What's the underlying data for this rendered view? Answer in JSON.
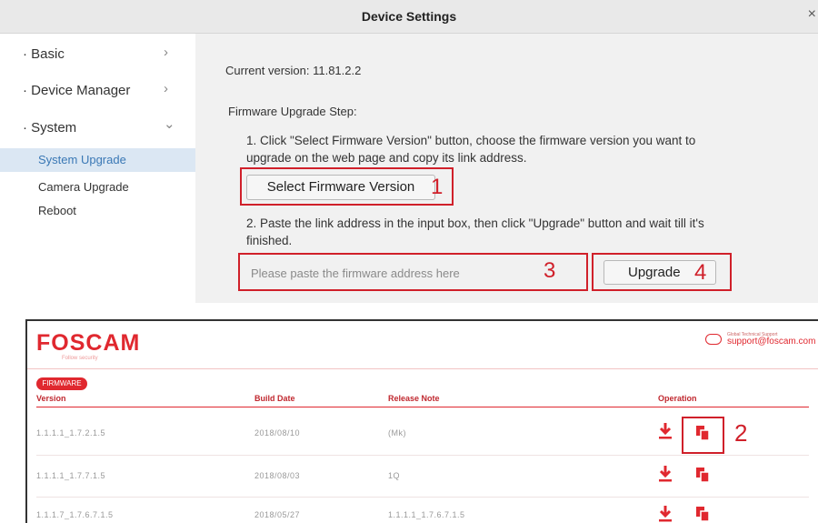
{
  "dialog": {
    "title": "Device Settings",
    "close_glyph": "×"
  },
  "sidebar": {
    "items": [
      {
        "label": "· Basic",
        "chevron": "›",
        "icon": "chevron-right-icon"
      },
      {
        "label": "· Device Manager",
        "chevron": "›",
        "icon": "chevron-right-icon"
      },
      {
        "label": "· System",
        "chevron": "⌄",
        "icon": "chevron-down-icon"
      }
    ],
    "subitems": [
      {
        "label": "System Upgrade",
        "active": true
      },
      {
        "label": "Camera Upgrade",
        "active": false
      },
      {
        "label": "Reboot",
        "active": false
      }
    ]
  },
  "content": {
    "current_version": "Current version: 11.81.2.2",
    "steps_title": "Firmware Upgrade Step:",
    "step1_line1": "1. Click \"Select Firmware Version\" button, choose the firmware version you want to",
    "step1_line2": "upgrade on the web page and copy its link address.",
    "select_button": "Select Firmware Version",
    "step2_line1": "2. Paste the link address in the input box, then click \"Upgrade\" button and wait till it's",
    "step2_line2": "finished.",
    "input_placeholder": "Please paste the firmware address here",
    "upgrade_button": "Upgrade",
    "callouts": {
      "one": "1",
      "three": "3",
      "four": "4"
    }
  },
  "foscam": {
    "logo": "FOSCAM",
    "tagline": "Follow security",
    "support_small": "Global Technical Support",
    "support_email": "support@foscam.com",
    "badge": "FIRMWARE",
    "columns": {
      "version": "Version",
      "build_date": "Build Date",
      "release_note": "Release Note",
      "operation": "Operation"
    },
    "rows": [
      {
        "version": "1.1.1.1_1.7.2.1.5",
        "build_date": "2018/08/10",
        "release_note": "(Mk)"
      },
      {
        "version": "1.1.1.1_1.7.7.1.5",
        "build_date": "2018/08/03",
        "release_note": "1Q"
      },
      {
        "version": "1.1.1.7_1.7.6.7.1.5",
        "build_date": "2018/05/27",
        "release_note": "1.1.1.1_1.7.6.7.1.5"
      }
    ],
    "callout_two": "2",
    "accent_color": "#e0282f"
  }
}
